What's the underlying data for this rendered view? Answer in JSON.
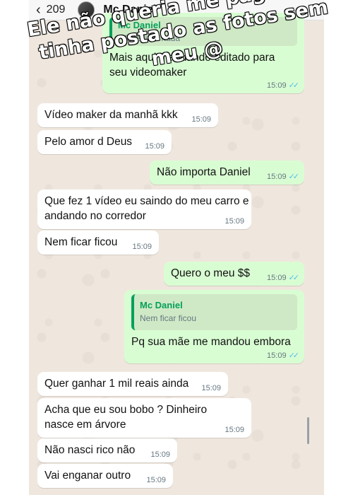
{
  "header": {
    "back_count": "209",
    "contact_name": "Mc Daniel"
  },
  "overlay_caption": "Ele não queria me pagar e já tinha postado as fotos sem meu @",
  "messages": [
    {
      "dir": "out",
      "quote_name": "Mc Daniel",
      "quote_text": "Não editou nada",
      "text": "Mais aqui mandando editado para seu videomaker",
      "time": "15:09",
      "ticks": "✓✓"
    },
    {
      "dir": "in",
      "text": "Vídeo maker da manhã kkk",
      "time": "15:09"
    },
    {
      "dir": "in",
      "text": "Pelo amor d Deus",
      "time": "15:09"
    },
    {
      "dir": "out",
      "text": "Não importa Daniel",
      "time": "15:09",
      "ticks": "✓✓"
    },
    {
      "dir": "in",
      "text": "Que fez 1 vídeo eu saindo do meu carro e andando no corredor",
      "time": "15:09"
    },
    {
      "dir": "in",
      "text": "Nem ficar ficou",
      "time": "15:09"
    },
    {
      "dir": "out",
      "text": "Quero o meu $$",
      "time": "15:09",
      "ticks": "✓✓"
    },
    {
      "dir": "out",
      "quote_name": "Mc Daniel",
      "quote_text": "Nem ficar ficou",
      "text": "Pq sua mãe me mandou embora",
      "time": "15:09",
      "ticks": "✓✓"
    },
    {
      "dir": "in",
      "text": "Quer ganhar 1 mil reais ainda",
      "time": "15:09"
    },
    {
      "dir": "in",
      "text": "Acha que eu sou bobo ? Dinheiro nasce em árvore",
      "time": "15:09"
    },
    {
      "dir": "in",
      "text": "Não nasci rico não",
      "time": "15:09"
    },
    {
      "dir": "in",
      "text": "Vai enganar outro",
      "time": "15:09"
    }
  ]
}
